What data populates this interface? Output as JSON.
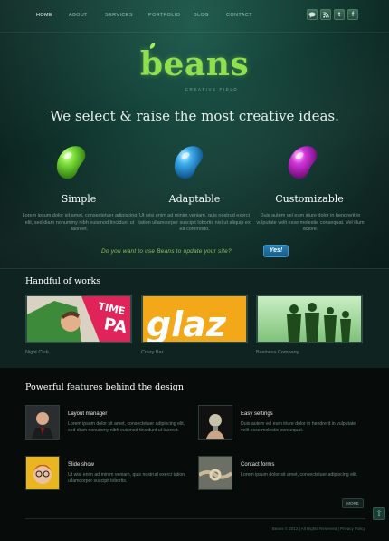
{
  "nav": {
    "items": [
      {
        "label": "HOME",
        "active": true
      },
      {
        "label": "ABOUT",
        "active": false
      },
      {
        "label": "SERVICES",
        "active": false
      },
      {
        "label": "PORTFOLIO",
        "active": false
      },
      {
        "label": "BLOG",
        "active": false
      },
      {
        "label": "CONTACT",
        "active": false
      }
    ],
    "social_icons": [
      "chat-icon",
      "rss-icon",
      "twitter-icon",
      "facebook-icon"
    ]
  },
  "brand": {
    "logo": "beans",
    "tagline": "CREATIVE FIELD"
  },
  "hero": {
    "headline": "We select & raise the most creative ideas.",
    "features": [
      {
        "title": "Simple",
        "text": "Lorem ipsum dolor sit amet, consectetuer adipiscing elit, sed diam nonummy nibh euismod tincidunt ut laoreet.",
        "bean_color": "#6fd43a"
      },
      {
        "title": "Adaptable",
        "text": "Ut wisi enim ad minim veniam, quis nostrud exerci tation ullamcorper suscipit lobortis nisl ut aliquip ex ea commodo.",
        "bean_color": "#3aa8e8"
      },
      {
        "title": "Customizable",
        "text": "Duis autem vel eum iriure dolor in hendrerit in vulputate velit esse molestie consequat. Vel illum dolore.",
        "bean_color": "#d12fd6"
      }
    ],
    "cta_text": "Do you want to use Beans to update your site?",
    "cta_button": "Yes!"
  },
  "works": {
    "title": "Handful of works",
    "items": [
      {
        "caption": "Night Club"
      },
      {
        "caption": "Crazy Bar"
      },
      {
        "caption": "Business Company"
      }
    ]
  },
  "features": {
    "title": "Powerful features behind the design",
    "items": [
      {
        "title": "Layout manager",
        "text": "Lorem ipsum dolor sit amet, consectetuer adipiscing elit, sed diam nonummy nibh euismod tincidunt ut laoreet."
      },
      {
        "title": "Easy settings",
        "text": "Duis autem vel eum iriure dolor in hendrerit in vulputate velit esse molestie consequat."
      },
      {
        "title": "Slide show",
        "text": "Ut wisi enim ad minim veniam, quis nostrud exerci tation ullamcorper suscipit lobortis."
      },
      {
        "title": "Contact forms",
        "text": "Lorem ipsum dolor sit amet, consectetuer adipiscing elit."
      }
    ],
    "more_button": "MORE"
  },
  "footer": {
    "text": "Beans © 2012 | All Rights Reserved | Privacy Policy"
  },
  "colors": {
    "accent_green": "#8ee04c",
    "cta_blue": "#2a7fb4"
  }
}
